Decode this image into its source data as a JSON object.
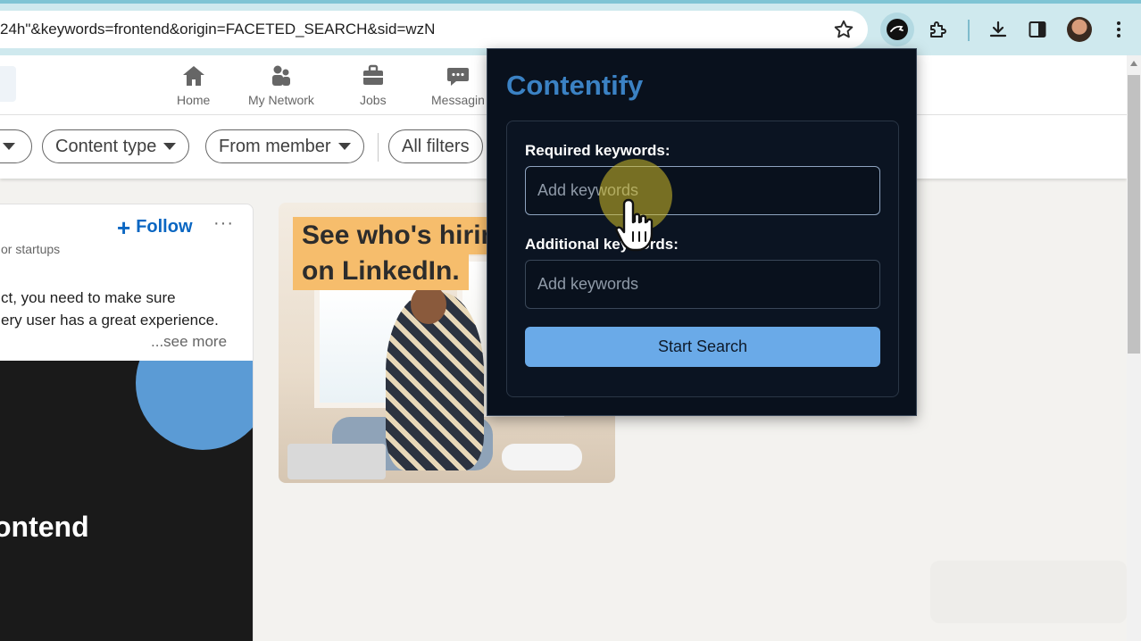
{
  "browser": {
    "url": "24h\"&keywords=frontend&origin=FACETED_SEARCH&sid=wzN",
    "icons": [
      "star-icon",
      "contentify-extension-icon",
      "puzzle-icon",
      "download-icon",
      "sidepanel-icon",
      "avatar",
      "menu-dots-icon"
    ]
  },
  "nav": {
    "items": [
      {
        "label": "Home",
        "icon": "home-icon"
      },
      {
        "label": "My Network",
        "icon": "network-icon"
      },
      {
        "label": "Jobs",
        "icon": "briefcase-icon"
      },
      {
        "label": "Messagin",
        "icon": "messaging-icon"
      }
    ]
  },
  "filters": {
    "content_type": "Content type",
    "from_member": "From member",
    "all_filters": "All filters"
  },
  "post": {
    "follow_label": "Follow",
    "more_label": "···",
    "subtitle": "or startups",
    "text_line1": "ct, you need to make sure",
    "text_line2": "ery user has a great experience.",
    "see_more": "...see more",
    "image_headline": "ontend"
  },
  "ad": {
    "line1": "See who's hiring",
    "line2": "on LinkedIn."
  },
  "popup": {
    "title": "Contentify",
    "required_label": "Required keywords:",
    "required_placeholder": "Add keywords",
    "required_value": "",
    "additional_label": "Additional keywords:",
    "additional_placeholder": "Add keywords",
    "additional_value": "",
    "button_label": "Start Search"
  },
  "colors": {
    "popup_bg": "#09111d",
    "title_blue": "#3b82c4",
    "button_blue": "#6aaae8",
    "linkedin_blue": "#0a66c2",
    "ad_orange": "#f6bd6c"
  }
}
